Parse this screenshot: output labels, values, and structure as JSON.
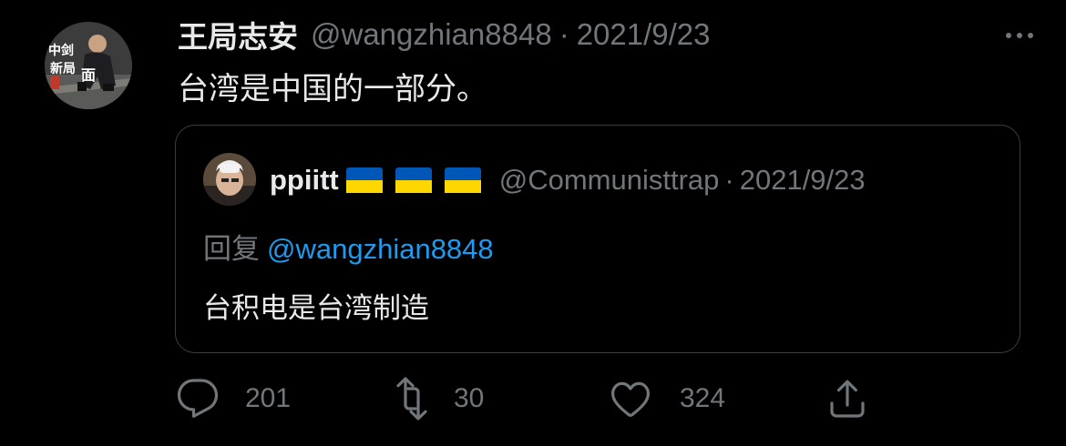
{
  "tweet": {
    "author_name": "王局志安",
    "author_handle": "@wangzhian8848",
    "separator": "·",
    "date": "2021/9/23",
    "text": "台湾是中国的一部分。",
    "avatar_overlay_text": "中剑新局面"
  },
  "quoted_tweet": {
    "author_name": "ppiitt",
    "author_handle": "@Communisttrap",
    "separator": "·",
    "date": "2021/9/23",
    "reply_label": "回复",
    "reply_mention": "@wangzhian8848",
    "text": "台积电是台湾制造",
    "name_flags": [
      "ukraine-flag",
      "ukraine-flag",
      "ukraine-flag"
    ]
  },
  "actions": {
    "reply_count": "201",
    "retweet_count": "30",
    "like_count": "324"
  },
  "colors": {
    "background": "#000000",
    "text_primary": "#e7e9ea",
    "text_secondary": "#71767b",
    "link": "#1d9bf0",
    "border": "#3a3d42",
    "flag_blue": "#0057b7",
    "flag_yellow": "#ffd700"
  }
}
